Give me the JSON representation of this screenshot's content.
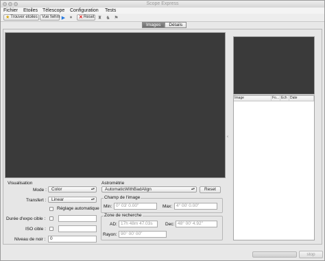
{
  "window": {
    "title": "Scope Express"
  },
  "menu": [
    "Fichier",
    "Etoiles",
    "Télescope",
    "Configuration",
    "Tests"
  ],
  "toolbar": {
    "find_stars": "Trouver etoiles",
    "fwhm_view": "Vue fwhm",
    "reset": "Reset"
  },
  "tabs": {
    "images": "Images",
    "details": "Détails",
    "active": "Images"
  },
  "list": {
    "columns": [
      "Image",
      "Fo...",
      "Ech",
      "Date"
    ]
  },
  "visualisation": {
    "title": "Visualisation",
    "mode_label": "Mode :",
    "mode_value": "Color",
    "transfert_label": "Transfert :",
    "transfert_value": "Linear",
    "auto_label": "Réglage automatique",
    "expo_label": "Durée d'expo cible :",
    "iso_label": "ISO cible :",
    "noir_label": "Niveau de noir :",
    "noir_value": "0"
  },
  "astrometrie": {
    "title": "Astrométrie",
    "method_value": "AutomaticWithBadAlign",
    "reset_label": "Reset",
    "champ_title": "Champ de l'image",
    "min_label": "Min:",
    "min_placeholder": "0° 03' 0.00\"",
    "max_label": "Max:",
    "max_placeholder": "4° 00' 0.00\"",
    "zone_title": "Zone de recherche",
    "ad_label": "AD:",
    "ad_placeholder": "17h 48m 47.03s",
    "dec_label": "Dec:",
    "dec_placeholder": "48° 00' 4.92\"",
    "rayon_label": "Rayon:",
    "rayon_placeholder": "90° 00' 00\""
  },
  "status": {
    "stop_label": "stop"
  },
  "colors": {
    "image_bg": "#3a3a3a",
    "accent_tab": "#7b7b7b"
  }
}
